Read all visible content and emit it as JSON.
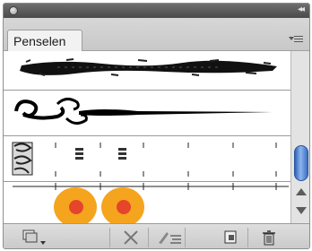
{
  "panel": {
    "tab_label": "Penselen"
  },
  "brushes": [
    {
      "type": "charcoal"
    },
    {
      "type": "calligraphic-ornament"
    },
    {
      "type": "pattern-border"
    },
    {
      "type": "art-circles"
    }
  ],
  "colors": {
    "circle_outer": "#f5a41e",
    "circle_inner": "#e5452b",
    "scroll_thumb": "#4a7fd4"
  },
  "toolbar_icons": [
    "brush-library-menu-icon",
    "remove-stroke-icon",
    "brush-options-icon",
    "new-brush-icon",
    "delete-brush-icon"
  ]
}
